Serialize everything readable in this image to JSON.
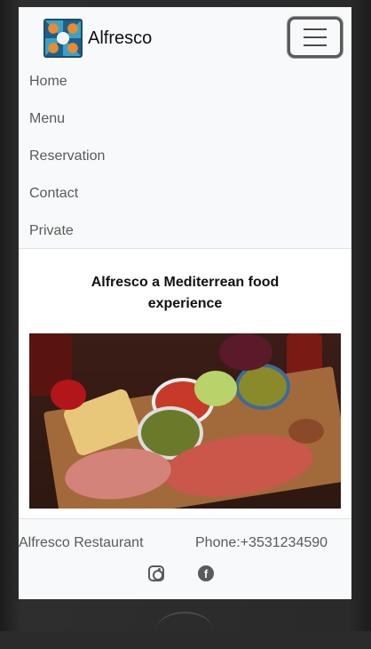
{
  "navbar": {
    "brand_name": "Alfresco",
    "logo_icon": "patterned-tile-logo-icon",
    "toggler_icon": "hamburger-menu-icon",
    "items": [
      {
        "label": "Home"
      },
      {
        "label": "Menu"
      },
      {
        "label": "Reservation"
      },
      {
        "label": "Contact"
      },
      {
        "label": "Private"
      }
    ]
  },
  "main": {
    "heading": "Alfresco a Mediterrean food experience",
    "image_alt": "Charcuterie board with cured meats, cheese, olives and fruit"
  },
  "footer": {
    "name": "Alfresco Restaurant",
    "phone": "Phone:+3531234590",
    "social_icons": [
      "instagram-icon",
      "facebook-icon"
    ]
  },
  "colors": {
    "navbar_bg": "#f8f9fa",
    "nav_text": "#5a5a5a",
    "heading_text": "#111111"
  }
}
